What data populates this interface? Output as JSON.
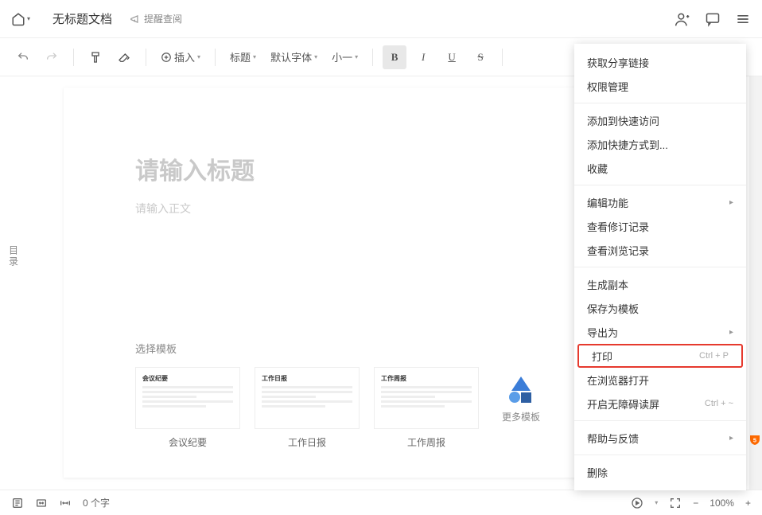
{
  "topbar": {
    "doc_title": "无标题文档",
    "remind": "提醒查阅"
  },
  "toolbar": {
    "insert": "插入",
    "heading": "标题",
    "font": "默认字体",
    "size": "小一",
    "bold": "B",
    "italic": "I",
    "underline": "U",
    "strike": "S"
  },
  "sidebar": {
    "toc": "目录"
  },
  "doc": {
    "title_placeholder": "请输入标题",
    "body_placeholder": "请输入正文"
  },
  "templates": {
    "header": "选择模板",
    "items": [
      {
        "name": "会议纪要",
        "thumb_title": "会议纪要"
      },
      {
        "name": "工作日报",
        "thumb_title": "工作日报"
      },
      {
        "name": "工作周报",
        "thumb_title": "工作周报"
      }
    ],
    "more": "更多模板"
  },
  "menu": {
    "groups": [
      [
        {
          "label": "获取分享链接"
        },
        {
          "label": "权限管理"
        }
      ],
      [
        {
          "label": "添加到快速访问"
        },
        {
          "label": "添加快捷方式到..."
        },
        {
          "label": "收藏"
        }
      ],
      [
        {
          "label": "编辑功能",
          "arrow": true
        },
        {
          "label": "查看修订记录"
        },
        {
          "label": "查看浏览记录"
        }
      ],
      [
        {
          "label": "生成副本"
        },
        {
          "label": "保存为模板"
        },
        {
          "label": "导出为",
          "arrow": true
        },
        {
          "label": "打印",
          "shortcut": "Ctrl + P",
          "highlight": true
        },
        {
          "label": "在浏览器打开"
        },
        {
          "label": "开启无障碍读屏",
          "shortcut": "Ctrl + ~"
        }
      ],
      [
        {
          "label": "帮助与反馈",
          "arrow": true
        }
      ],
      [
        {
          "label": "删除"
        }
      ]
    ]
  },
  "statusbar": {
    "word_count": "0 个字",
    "zoom": "100%"
  }
}
